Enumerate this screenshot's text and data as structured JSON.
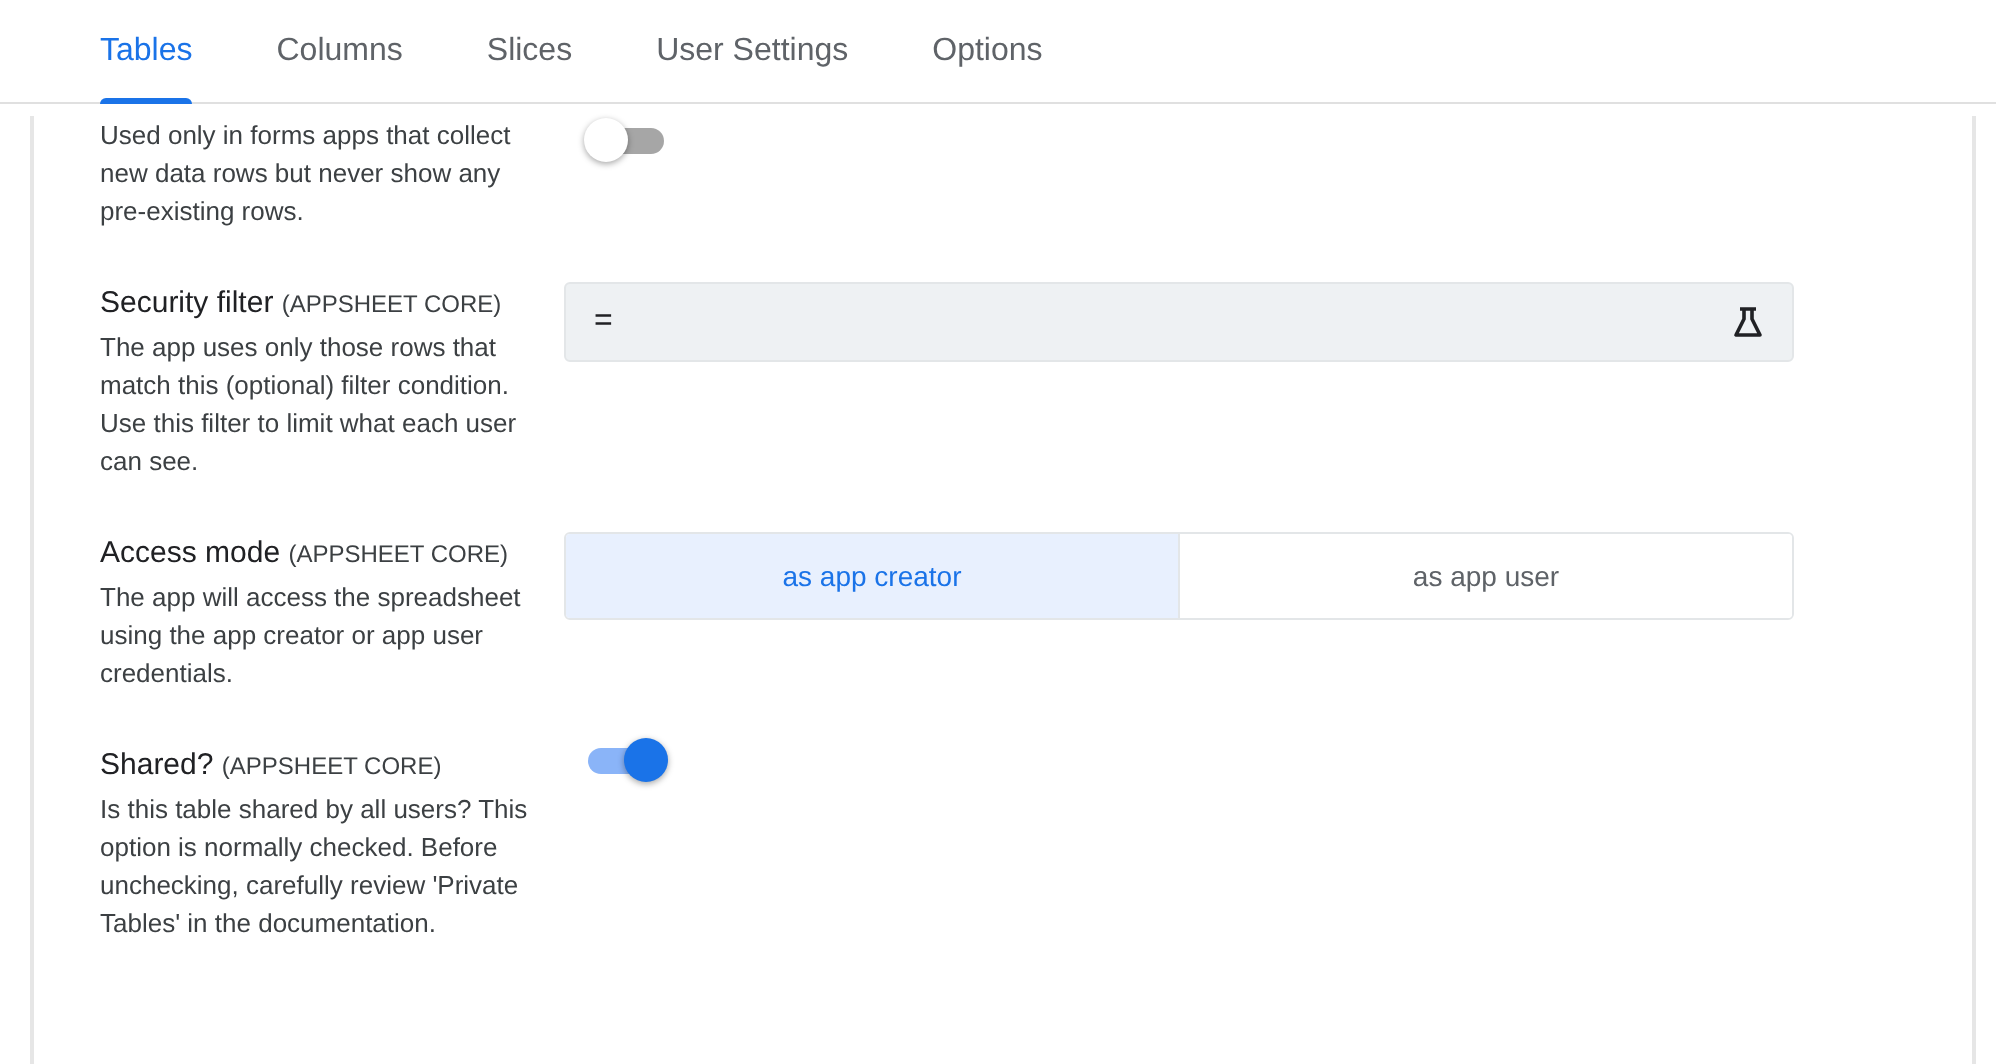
{
  "tabs": [
    {
      "label": "Tables",
      "selected": true
    },
    {
      "label": "Columns",
      "selected": false
    },
    {
      "label": "Slices",
      "selected": false
    },
    {
      "label": "User Settings",
      "selected": false
    },
    {
      "label": "Options",
      "selected": false
    }
  ],
  "settings": [
    {
      "kind": "toggle",
      "description": "Used only in forms apps that collect new data rows but never show any pre-existing rows.",
      "on": false
    },
    {
      "kind": "formula",
      "title": "Security filter",
      "tag": "(APPSHEET CORE)",
      "description": "The app uses only those rows that match this (optional) filter condition. Use this filter to limit what each user can see.",
      "value": "="
    },
    {
      "kind": "segmented",
      "title": "Access mode",
      "tag": "(APPSHEET CORE)",
      "description": "The app will access the spreadsheet using the app creator or app user credentials.",
      "options": [
        {
          "label": "as app creator",
          "selected": true
        },
        {
          "label": "as app user",
          "selected": false
        }
      ]
    },
    {
      "kind": "toggle",
      "title": "Shared?",
      "tag": "(APPSHEET CORE)",
      "description": "Is this table shared by all users? This option is normally checked. Before unchecking, carefully review 'Private Tables' in the documentation.",
      "on": true
    }
  ]
}
